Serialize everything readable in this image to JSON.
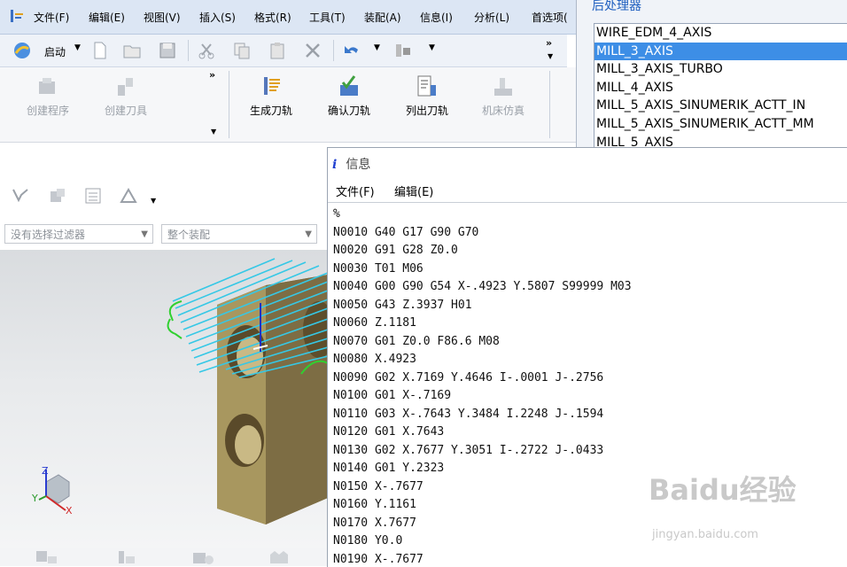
{
  "menubar": {
    "items": [
      "文件(F)",
      "编辑(E)",
      "视图(V)",
      "插入(S)",
      "格式(R)",
      "工具(T)",
      "装配(A)",
      "信息(I)",
      "分析(L)",
      "首选项("
    ]
  },
  "stdbar": {
    "start_label": "启动"
  },
  "ribbon": {
    "buttons": [
      "创建程序",
      "创建刀具",
      "生成刀轨",
      "确认刀轨",
      "列出刀轨",
      "机床仿真"
    ]
  },
  "filters": {
    "selection_filter": "没有选择过滤器",
    "assembly_scope": "整个装配"
  },
  "postprocessor": {
    "title": "后处理器",
    "items": [
      "WIRE_EDM_4_AXIS",
      "MILL_3_AXIS",
      "MILL_3_AXIS_TURBO",
      "MILL_4_AXIS",
      "MILL_5_AXIS_SINUMERIK_ACTT_IN",
      "MILL_5_AXIS_SINUMERIK_ACTT_MM",
      "MILL_5_AXIS"
    ],
    "selected": "MILL_3_AXIS"
  },
  "info_window": {
    "title": "信息",
    "menu": [
      "文件(F)",
      "编辑(E)"
    ],
    "lines": [
      "%",
      "N0010 G40 G17 G90 G70",
      "N0020 G91 G28 Z0.0",
      "N0030 T01 M06",
      "N0040 G00 G90 G54 X-.4923 Y.5807 S99999 M03",
      "N0050 G43 Z.3937 H01",
      "N0060 Z.1181",
      "N0070 G01 Z0.0 F86.6 M08",
      "N0080 X.4923",
      "N0090 G02 X.7169 Y.4646 I-.0001 J-.2756",
      "N0100 G01 X-.7169",
      "N0110 G03 X-.7643 Y.3484 I.2248 J-.1594",
      "N0120 G01 X.7643",
      "N0130 G02 X.7677 Y.3051 I-.2722 J-.0433",
      "N0140 G01 Y.2323",
      "N0150 X-.7677",
      "N0160 Y.1161",
      "N0170 X.7677",
      "N0180 Y0.0",
      "N0190 X-.7677"
    ]
  },
  "viewport": {
    "axis_z": "Z",
    "axis_y": "Y",
    "axis_x": "X"
  },
  "watermark": {
    "brand": "Baidu经验",
    "url": "jingyan.baidu.com"
  },
  "colors": {
    "menubar_bg": "#dce6f4",
    "selection": "#3d8ee6",
    "toolpath": "#35c8e6",
    "part": "#8f7f55"
  }
}
